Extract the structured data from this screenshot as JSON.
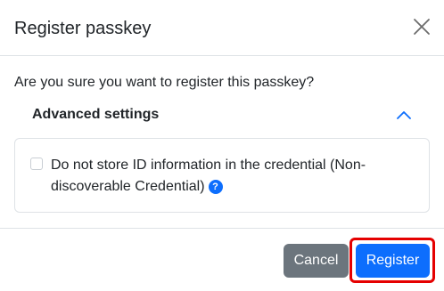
{
  "dialog": {
    "title": "Register passkey",
    "question": "Are you sure you want to register this passkey?",
    "advanced": {
      "title": "Advanced settings",
      "expanded": true,
      "checkbox_label": "Do not store ID information in the credential (Non-discoverable Credential)",
      "checkbox_checked": false,
      "help_symbol": "?"
    },
    "buttons": {
      "cancel_label": "Cancel",
      "register_label": "Register"
    }
  },
  "colors": {
    "primary": "#0d6efd",
    "secondary": "#6c757d",
    "highlight": "#e50000",
    "border": "#dee2e6"
  },
  "icons": {
    "close": "close-icon",
    "chevron": "chevron-up-icon",
    "help": "question-circle-icon"
  }
}
